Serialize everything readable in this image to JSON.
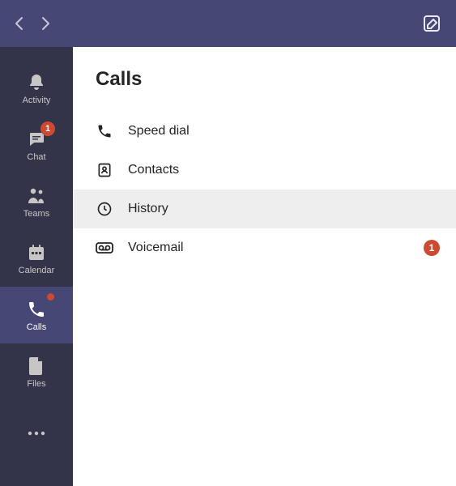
{
  "nav": {
    "items": [
      {
        "id": "activity",
        "label": "Activity",
        "selected": false,
        "badge": null,
        "dot": false
      },
      {
        "id": "chat",
        "label": "Chat",
        "selected": false,
        "badge": "1",
        "dot": false
      },
      {
        "id": "teams",
        "label": "Teams",
        "selected": false,
        "badge": null,
        "dot": false
      },
      {
        "id": "calendar",
        "label": "Calendar",
        "selected": false,
        "badge": null,
        "dot": false
      },
      {
        "id": "calls",
        "label": "Calls",
        "selected": true,
        "badge": null,
        "dot": true
      },
      {
        "id": "files",
        "label": "Files",
        "selected": false,
        "badge": null,
        "dot": false
      }
    ]
  },
  "panel": {
    "title": "Calls",
    "items": [
      {
        "id": "speeddial",
        "label": "Speed dial",
        "selected": false,
        "badge": null
      },
      {
        "id": "contacts",
        "label": "Contacts",
        "selected": false,
        "badge": null
      },
      {
        "id": "history",
        "label": "History",
        "selected": true,
        "badge": null
      },
      {
        "id": "voicemail",
        "label": "Voicemail",
        "selected": false,
        "badge": "1"
      }
    ]
  },
  "colors": {
    "brand": "#464775",
    "railBg": "#33344a",
    "badge": "#cc4a31"
  }
}
